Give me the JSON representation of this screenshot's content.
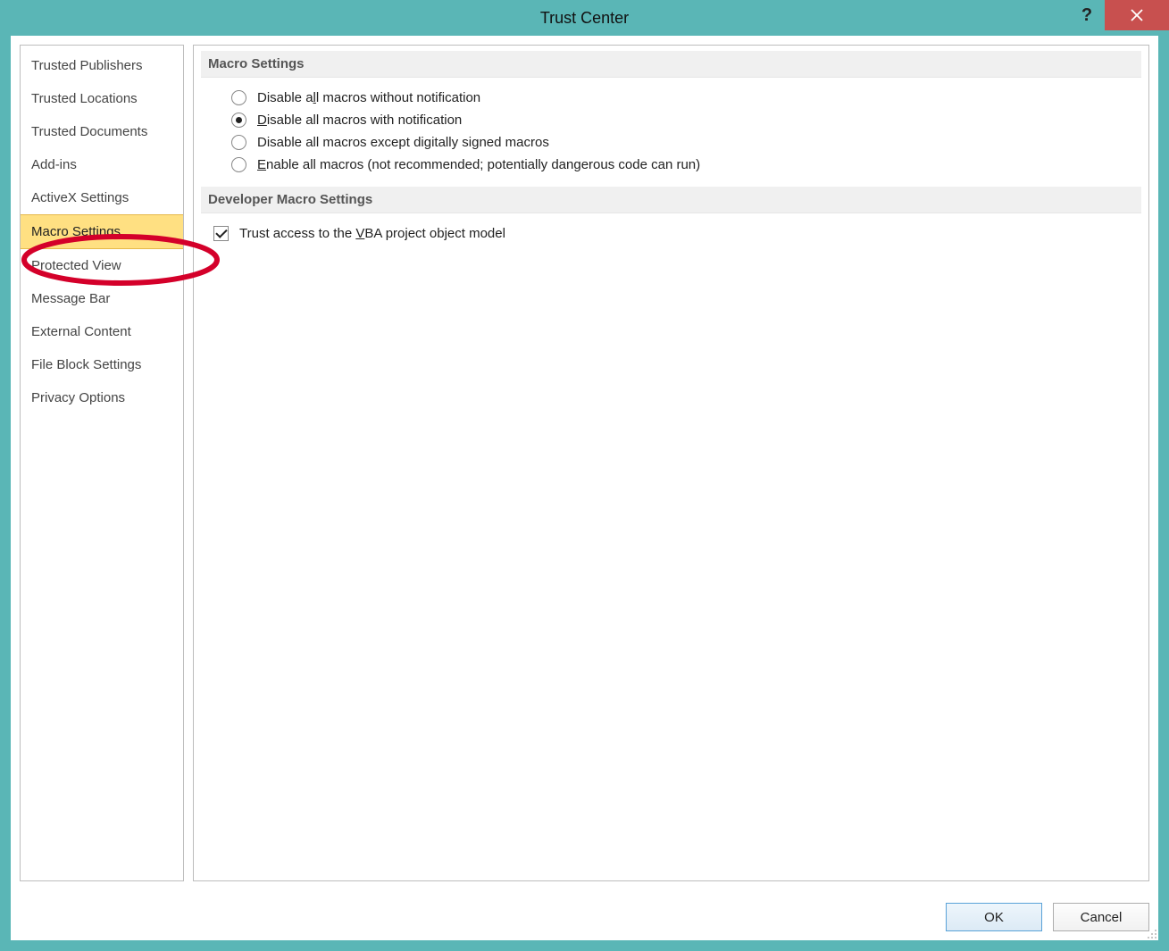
{
  "window": {
    "title": "Trust Center"
  },
  "sidebar": {
    "items": [
      {
        "label": "Trusted Publishers",
        "selected": false
      },
      {
        "label": "Trusted Locations",
        "selected": false
      },
      {
        "label": "Trusted Documents",
        "selected": false
      },
      {
        "label": "Add-ins",
        "selected": false
      },
      {
        "label": "ActiveX Settings",
        "selected": false
      },
      {
        "label": "Macro Settings",
        "selected": true
      },
      {
        "label": "Protected View",
        "selected": false
      },
      {
        "label": "Message Bar",
        "selected": false
      },
      {
        "label": "External Content",
        "selected": false
      },
      {
        "label": "File Block Settings",
        "selected": false
      },
      {
        "label": "Privacy Options",
        "selected": false
      }
    ]
  },
  "main": {
    "section1": {
      "title": "Macro Settings",
      "options": [
        {
          "label_pre": "Disable a",
          "accel": "l",
          "label_post": "l macros without notification",
          "checked": false
        },
        {
          "label_pre": "",
          "accel": "D",
          "label_post": "isable all macros with notification",
          "checked": true
        },
        {
          "label_pre": "Disable all macros except digitally si",
          "accel": "g",
          "label_post": "ned macros",
          "checked": false
        },
        {
          "label_pre": "",
          "accel": "E",
          "label_post": "nable all macros (not recommended; potentially dangerous code can run)",
          "checked": false
        }
      ]
    },
    "section2": {
      "title": "Developer Macro Settings",
      "checkbox": {
        "label_pre": "Trust access to the ",
        "accel": "V",
        "label_post": "BA project object model",
        "checked": true
      }
    }
  },
  "footer": {
    "ok": "OK",
    "cancel": "Cancel"
  },
  "annotation": {
    "highlighted_sidebar_item": "Macro Settings"
  }
}
